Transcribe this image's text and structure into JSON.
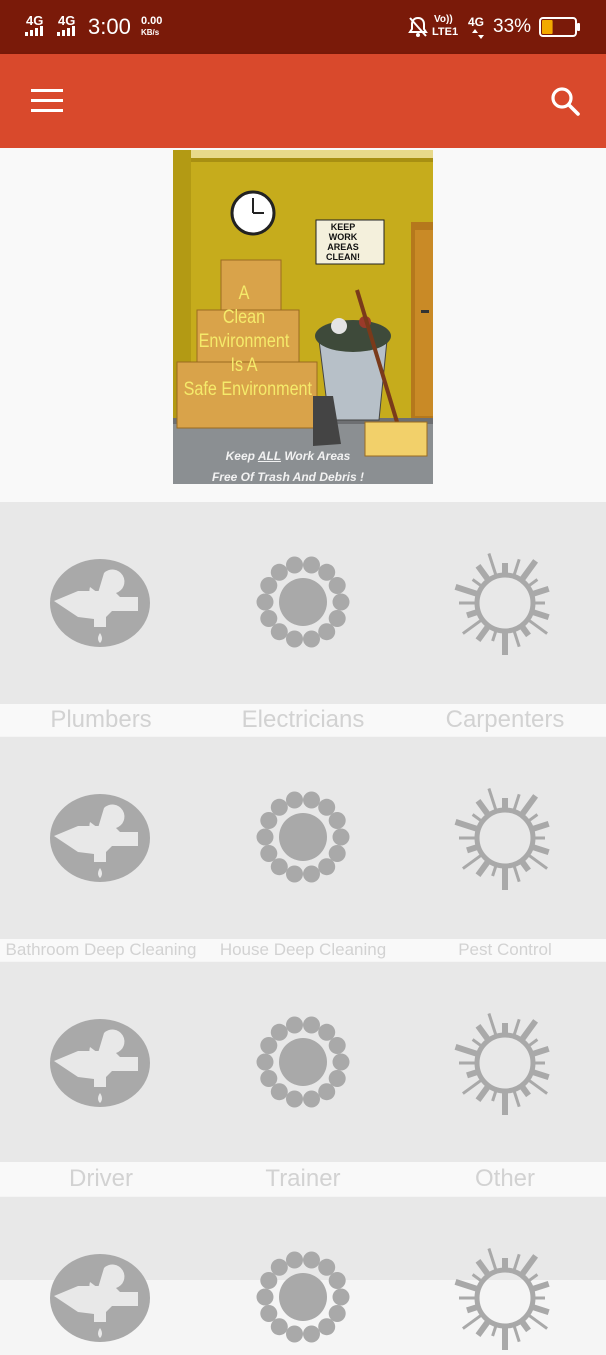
{
  "status_bar": {
    "signal1": "4G",
    "signal2": "4G",
    "time": "3:00",
    "speed_value": "0.00",
    "speed_unit": "KB/s",
    "volte_top": "Vo))",
    "volte_bottom": "LTE1",
    "network": "4G",
    "battery_percent": "33%",
    "battery_level": 0.33
  },
  "app_bar": {
    "menu_icon": "hamburger-menu-icon",
    "search_icon": "search-icon"
  },
  "banner": {
    "sign_text": [
      "KEEP",
      "WORK",
      "AREAS",
      "CLEAN!"
    ],
    "box_lines": [
      "A",
      "Clean",
      "Environment",
      "Is A",
      "Safe Environment"
    ],
    "footer_line1_pre": "Keep ",
    "footer_line1_em": "ALL",
    "footer_line1_post": " Work Areas",
    "footer_line2": "Free Of Trash And Debris !",
    "colors": {
      "wall": "#c6ac1c",
      "floor": "#8b8f92",
      "box": "#d9a34a",
      "box_text": "#f5ea6a"
    }
  },
  "services": [
    {
      "label": "Plumbers",
      "icon": "plumbing-icon"
    },
    {
      "label": "Electricians",
      "icon": "electrical-icon"
    },
    {
      "label": "Carpenters",
      "icon": "tools-globe-icon"
    },
    {
      "label": "Bathroom Deep Cleaning",
      "icon": "plumbing-icon"
    },
    {
      "label": "House Deep Cleaning",
      "icon": "electrical-icon"
    },
    {
      "label": "Pest Control",
      "icon": "tools-globe-icon"
    },
    {
      "label": "Driver",
      "icon": "plumbing-icon"
    },
    {
      "label": "Trainer",
      "icon": "electrical-icon"
    },
    {
      "label": "Other",
      "icon": "tools-globe-icon"
    }
  ],
  "colors": {
    "status_bar": "#7a1a09",
    "app_bar": "#d9492c",
    "icon_gray": "#a9a9a9",
    "label_gray": "#d2d2d2",
    "battery_fill": "#f2a900"
  }
}
